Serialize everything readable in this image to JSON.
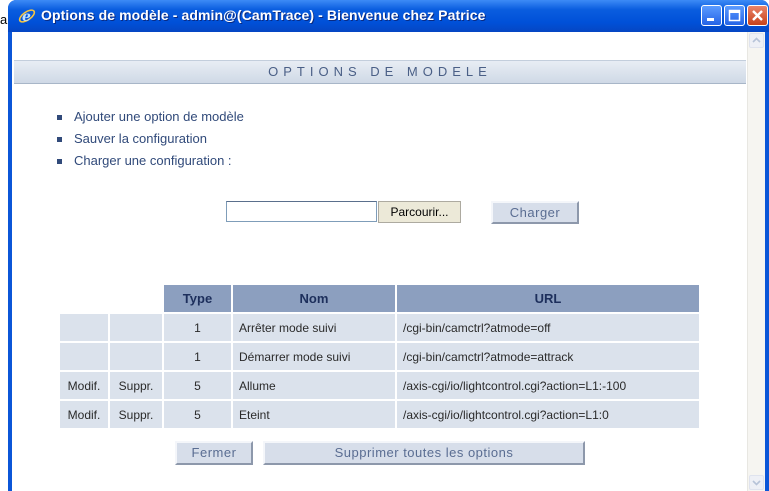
{
  "edge_text": "a",
  "window": {
    "title": "Options de modèle - admin@(CamTrace) - Bienvenue chez Patrice"
  },
  "page": {
    "heading": "OPTIONS DE MODELE",
    "links": [
      "Ajouter une option de modèle",
      "Sauver la configuration",
      "Charger une configuration :"
    ],
    "file_input_value": "",
    "browse_label": "Parcourir...",
    "load_label": "Charger"
  },
  "table": {
    "headers": [
      "",
      "",
      "Type",
      "Nom",
      "URL"
    ],
    "rows": [
      {
        "modif": "",
        "suppr": "",
        "type": "1",
        "nom": "Arrêter mode suivi",
        "url": "/cgi-bin/camctrl?atmode=off"
      },
      {
        "modif": "",
        "suppr": "",
        "type": "1",
        "nom": "Démarrer mode suivi",
        "url": "/cgi-bin/camctrl?atmode=attrack"
      },
      {
        "modif": "Modif.",
        "suppr": "Suppr.",
        "type": "5",
        "nom": "Allume",
        "url": "/axis-cgi/io/lightcontrol.cgi?action=L1:-100"
      },
      {
        "modif": "Modif.",
        "suppr": "Suppr.",
        "type": "5",
        "nom": "Eteint",
        "url": "/axis-cgi/io/lightcontrol.cgi?action=L1:0"
      }
    ]
  },
  "footer": {
    "close_label": "Fermer",
    "delete_all_label": "Supprimer toutes les options"
  },
  "colors": {
    "titlebar": "#0050d8",
    "header_bar_text": "#4a5f86",
    "link_text": "#314a7a",
    "table_header_bg": "#8c9fbf",
    "table_cell_bg": "#dbe2ec",
    "button_bg": "#d7deea"
  },
  "icons": [
    "ie-icon",
    "minimize-icon",
    "maximize-icon",
    "close-icon",
    "scroll-up-icon",
    "scroll-down-icon"
  ]
}
